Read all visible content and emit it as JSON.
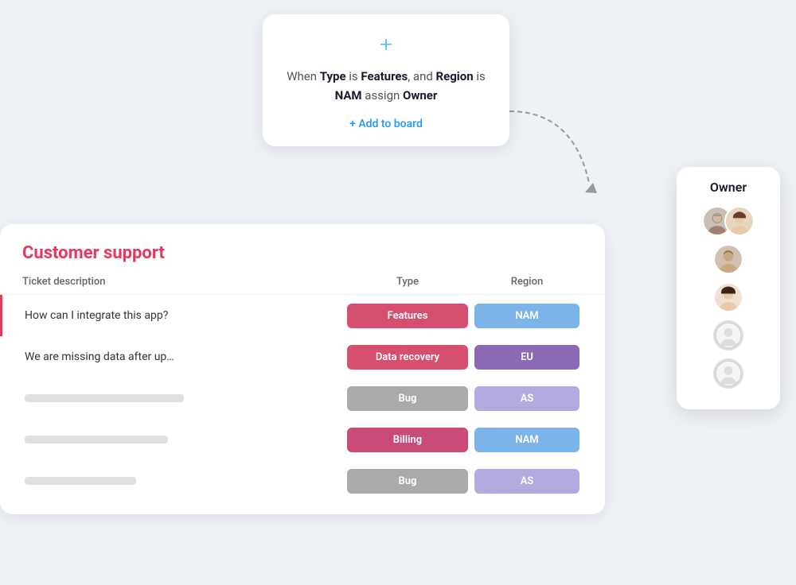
{
  "scene": {
    "background_color": "#eef1f6"
  },
  "rule_card": {
    "plus_icon": "+",
    "rule_text_parts": [
      {
        "text": "When ",
        "bold": false
      },
      {
        "text": "Type",
        "bold": true
      },
      {
        "text": " is ",
        "bold": false
      },
      {
        "text": "Features",
        "bold": true
      },
      {
        "text": ", and ",
        "bold": false
      },
      {
        "text": "Region",
        "bold": true
      },
      {
        "text": " is ",
        "bold": false
      },
      {
        "text": "NAM",
        "bold": true
      },
      {
        "text": " assign ",
        "bold": false
      },
      {
        "text": "Owner",
        "bold": true
      }
    ],
    "add_to_board_label": "+ Add to board"
  },
  "owner_panel": {
    "title": "Owner",
    "avatars": [
      {
        "type": "double",
        "label": "Two avatars"
      },
      {
        "type": "single-male",
        "label": "Male avatar"
      },
      {
        "type": "single-female",
        "label": "Female avatar"
      },
      {
        "type": "placeholder",
        "label": "Empty avatar 1"
      },
      {
        "type": "placeholder",
        "label": "Empty avatar 2"
      }
    ]
  },
  "table": {
    "section_title": "Customer support",
    "columns": [
      "Ticket description",
      "Type",
      "Region"
    ],
    "rows": [
      {
        "description": "How can I integrate this app?",
        "type": "Features",
        "type_class": "type-features",
        "region": "NAM",
        "region_class": "region-nam",
        "highlighted": true,
        "placeholder": false
      },
      {
        "description": "We are missing data after upgra...",
        "type": "Data recovery",
        "type_class": "type-data-recovery",
        "region": "EU",
        "region_class": "region-eu",
        "highlighted": false,
        "placeholder": false
      },
      {
        "description": "",
        "type": "Bug",
        "type_class": "type-bug",
        "region": "AS",
        "region_class": "region-as",
        "highlighted": false,
        "placeholder": true,
        "placeholder_width": 200
      },
      {
        "description": "",
        "type": "Billing",
        "type_class": "type-billing",
        "region": "NAM",
        "region_class": "region-nam",
        "highlighted": false,
        "placeholder": true,
        "placeholder_width": 180
      },
      {
        "description": "",
        "type": "Bug",
        "type_class": "type-bug",
        "region": "AS",
        "region_class": "region-as",
        "highlighted": false,
        "placeholder": true,
        "placeholder_width": 140
      }
    ]
  }
}
